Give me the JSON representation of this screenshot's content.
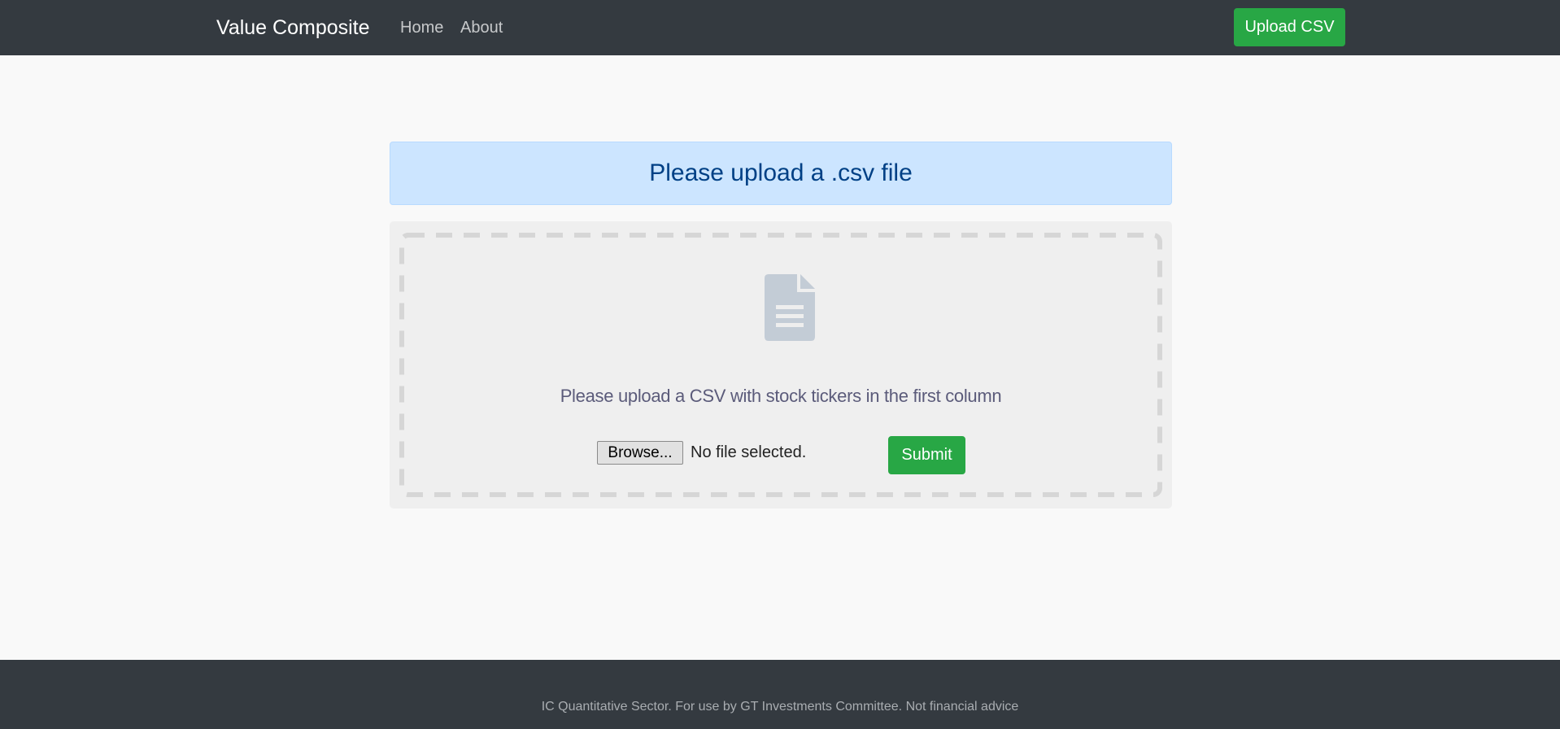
{
  "navbar": {
    "brand": "Value Composite",
    "links": [
      "Home",
      "About"
    ],
    "upload_button": "Upload CSV"
  },
  "alert": {
    "message": "Please upload a .csv file"
  },
  "upload": {
    "icon": "file-text-icon",
    "instruction": "Please upload a CSV with stock tickers in the first column",
    "browse_label": "Browse...",
    "file_status": "No file selected.",
    "submit_label": "Submit"
  },
  "footer": {
    "text": "IC Quantitative Sector. For use by GT Investments Committee. Not financial advice"
  },
  "colors": {
    "navbar_bg": "#343a40",
    "accent_green": "#28a745",
    "alert_bg": "#cce5ff",
    "alert_text": "#004085",
    "card_bg": "#efefef",
    "icon": "#c3ccd6"
  }
}
